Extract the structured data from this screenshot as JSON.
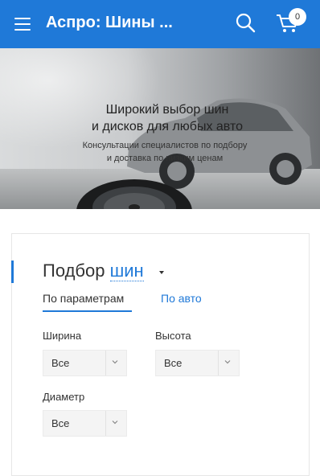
{
  "header": {
    "title": "Аспро: Шины ...",
    "cart_count": "0",
    "colors": {
      "accent": "#1f79d8"
    }
  },
  "banner": {
    "headline_line1": "Широкий выбор шин",
    "headline_line2": "и дисков для любых авто",
    "sub_line1": "Консультации специалистов по подбору",
    "sub_line2": "и доставка по низким ценам"
  },
  "selector": {
    "title_prefix": "Подбор",
    "title_link": "шин",
    "tabs": [
      {
        "label": "По параметрам",
        "active": true
      },
      {
        "label": "По авто",
        "active": false
      }
    ],
    "fields": [
      {
        "label": "Ширина",
        "value": "Все"
      },
      {
        "label": "Высота",
        "value": "Все"
      },
      {
        "label": "Диаметр",
        "value": "Все"
      }
    ]
  },
  "icons": [
    "menu-icon",
    "search-icon",
    "cart-icon",
    "chevron-down-icon"
  ]
}
